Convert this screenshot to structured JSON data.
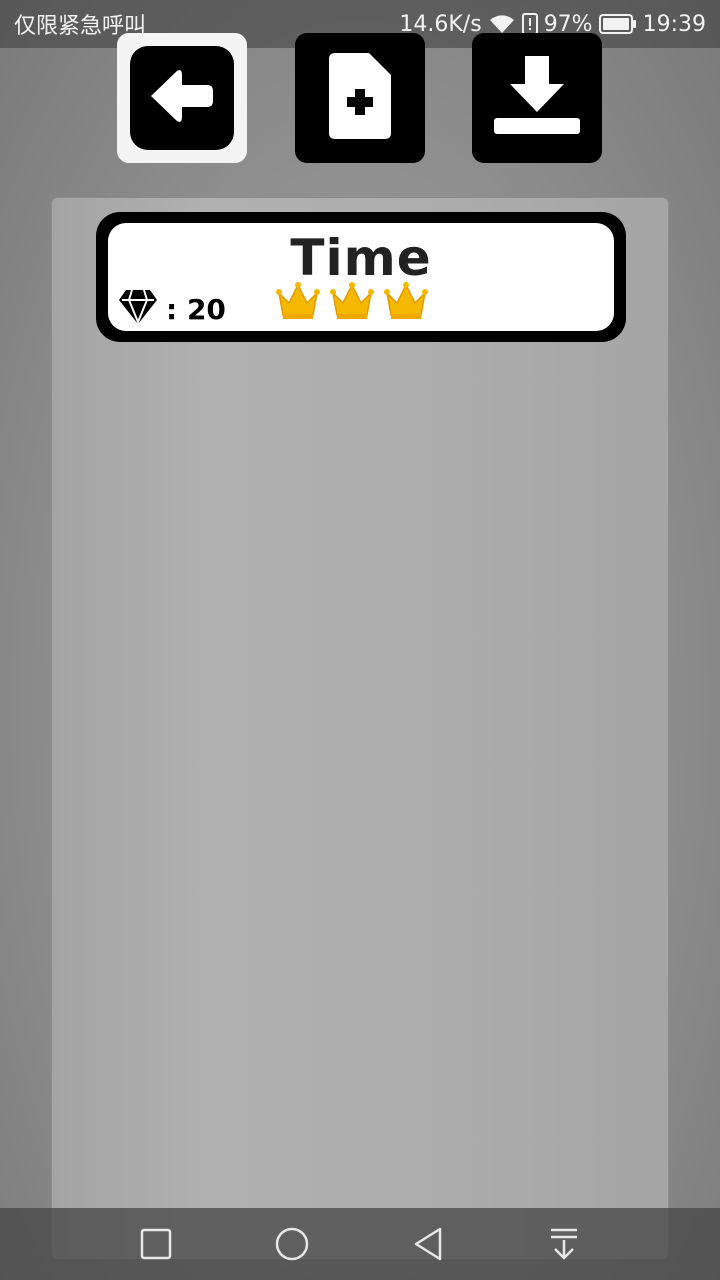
{
  "status_bar": {
    "carrier_text": "仅限紧急呼叫",
    "net_speed": "14.6K/s",
    "battery_percent": "97%",
    "time": "19:39"
  },
  "toolbar": {
    "buttons": [
      {
        "icon": "back-arrow-icon",
        "selected": true
      },
      {
        "icon": "new-file-icon",
        "selected": false
      },
      {
        "icon": "download-icon",
        "selected": false
      }
    ]
  },
  "level_card": {
    "title": "Time",
    "gem_count": ": 20",
    "crowns": 3
  },
  "colors": {
    "crown": "#f5b800",
    "card_border": "#000000",
    "panel": "#adadad"
  }
}
